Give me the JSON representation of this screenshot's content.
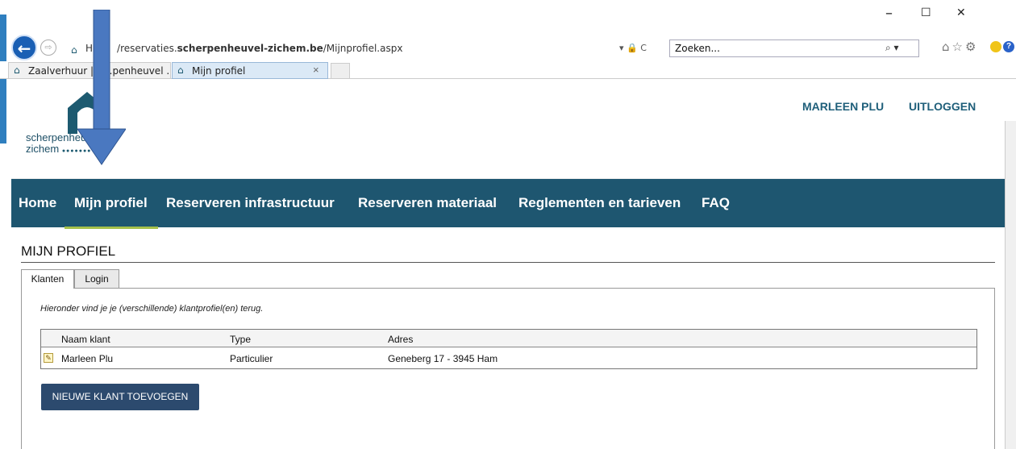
{
  "browser": {
    "url_prefix": "H",
    "url_path": "/reservaties.",
    "url_domain": "scherpenheuvel-zichem.be",
    "url_suffix": "/Mijnprofiel.aspx",
    "url_icons": "▾ 🔒 C",
    "search_placeholder": "Zoeken...",
    "search_icon": "⌕ ▾",
    "tool_icons": "⌂☆⚙",
    "win_min": "–",
    "win_max": "☐",
    "win_close": "✕",
    "tabs": [
      {
        "label": "Zaalverhuur | S…penheuvel ..."
      },
      {
        "label": "Mijn profiel"
      }
    ],
    "tab_close": "×",
    "help": "?"
  },
  "header": {
    "logo_line1": "scherpenheu",
    "logo_line2": "zichem",
    "logo_dots": "●●●●●●●",
    "user_name": "MARLEEN PLU",
    "logout": "UITLOGGEN"
  },
  "nav": {
    "items": [
      {
        "label": "Home"
      },
      {
        "label": "Mijn profiel"
      },
      {
        "label": "Reserveren infrastructuur"
      },
      {
        "label": "Reserveren materiaal"
      },
      {
        "label": "Reglementen en tarieven"
      },
      {
        "label": "FAQ"
      }
    ]
  },
  "main": {
    "title": "MIJN PROFIEL",
    "tabs": [
      {
        "label": "Klanten"
      },
      {
        "label": "Login"
      }
    ],
    "intro": "Hieronder vind je je (verschillende) klantprofiel(en) terug.",
    "table": {
      "headers": [
        "Naam klant",
        "Type",
        "Adres"
      ],
      "rows": [
        {
          "naam": "Marleen Plu",
          "type": "Particulier",
          "adres": "Geneberg 17 - 3945 Ham"
        }
      ]
    },
    "add_button": "NIEUWE KLANT TOEVOEGEN"
  },
  "colors": {
    "navbar": "#1e5670",
    "nav_active": "#a5c04a",
    "button": "#2c4a6e",
    "arrow": "#4a78c0"
  }
}
